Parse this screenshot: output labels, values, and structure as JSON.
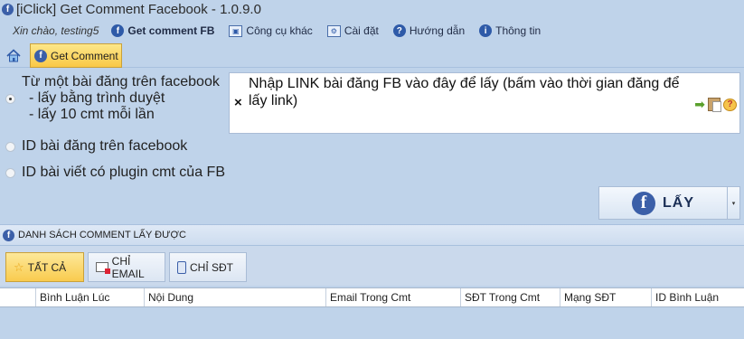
{
  "window": {
    "title": "[iClick] Get Comment Facebook - 1.0.9.0",
    "app_icon_glyph": "f"
  },
  "menu": {
    "greeting": "Xin chào, testing5",
    "items": [
      {
        "label": "Get comment FB",
        "icon": "facebook-icon"
      },
      {
        "label": "Công cụ khác",
        "icon": "tools-icon"
      },
      {
        "label": "Cài đặt",
        "icon": "settings-icon"
      },
      {
        "label": "Hướng dẫn",
        "icon": "help-icon"
      },
      {
        "label": "Thông tin",
        "icon": "info-icon"
      }
    ]
  },
  "tabs": {
    "home_icon": "home-icon",
    "active_label": "Get Comment"
  },
  "source_options": {
    "selected": 0,
    "options": [
      {
        "label": "Từ một bài đăng trên facebook",
        "sub": [
          "- lấy bằng trình duyệt",
          "- lấy 10 cmt mỗi lần"
        ]
      },
      {
        "label": "ID bài đăng trên facebook"
      },
      {
        "label": "ID bài viết có plugin cmt của FB"
      }
    ]
  },
  "link_input": {
    "placeholder": "Nhập LINK bài đăng FB vào đây để lấy (bấm vào thời gian đăng để lấy link)",
    "clear_glyph": "×"
  },
  "get_button": {
    "label": "LẤY",
    "icon_glyph": "f",
    "dropdown_glyph": "▾"
  },
  "comments_section": {
    "title": "DANH SÁCH COMMENT LẤY ĐƯỢC",
    "filters": [
      {
        "label": "TẤT CẢ",
        "active": true
      },
      {
        "label": "CHỈ EMAIL",
        "active": false
      },
      {
        "label": "CHỈ SĐT",
        "active": false
      }
    ],
    "columns": [
      "",
      "Bình Luận Lúc",
      "Nội Dung",
      "Email Trong Cmt",
      "SĐT Trong Cmt",
      "Mạng SĐT",
      "ID Bình Luận"
    ]
  },
  "colors": {
    "background": "#bfd3ea",
    "active_tab": "#f9c846",
    "facebook_blue": "#3b5fa8"
  }
}
